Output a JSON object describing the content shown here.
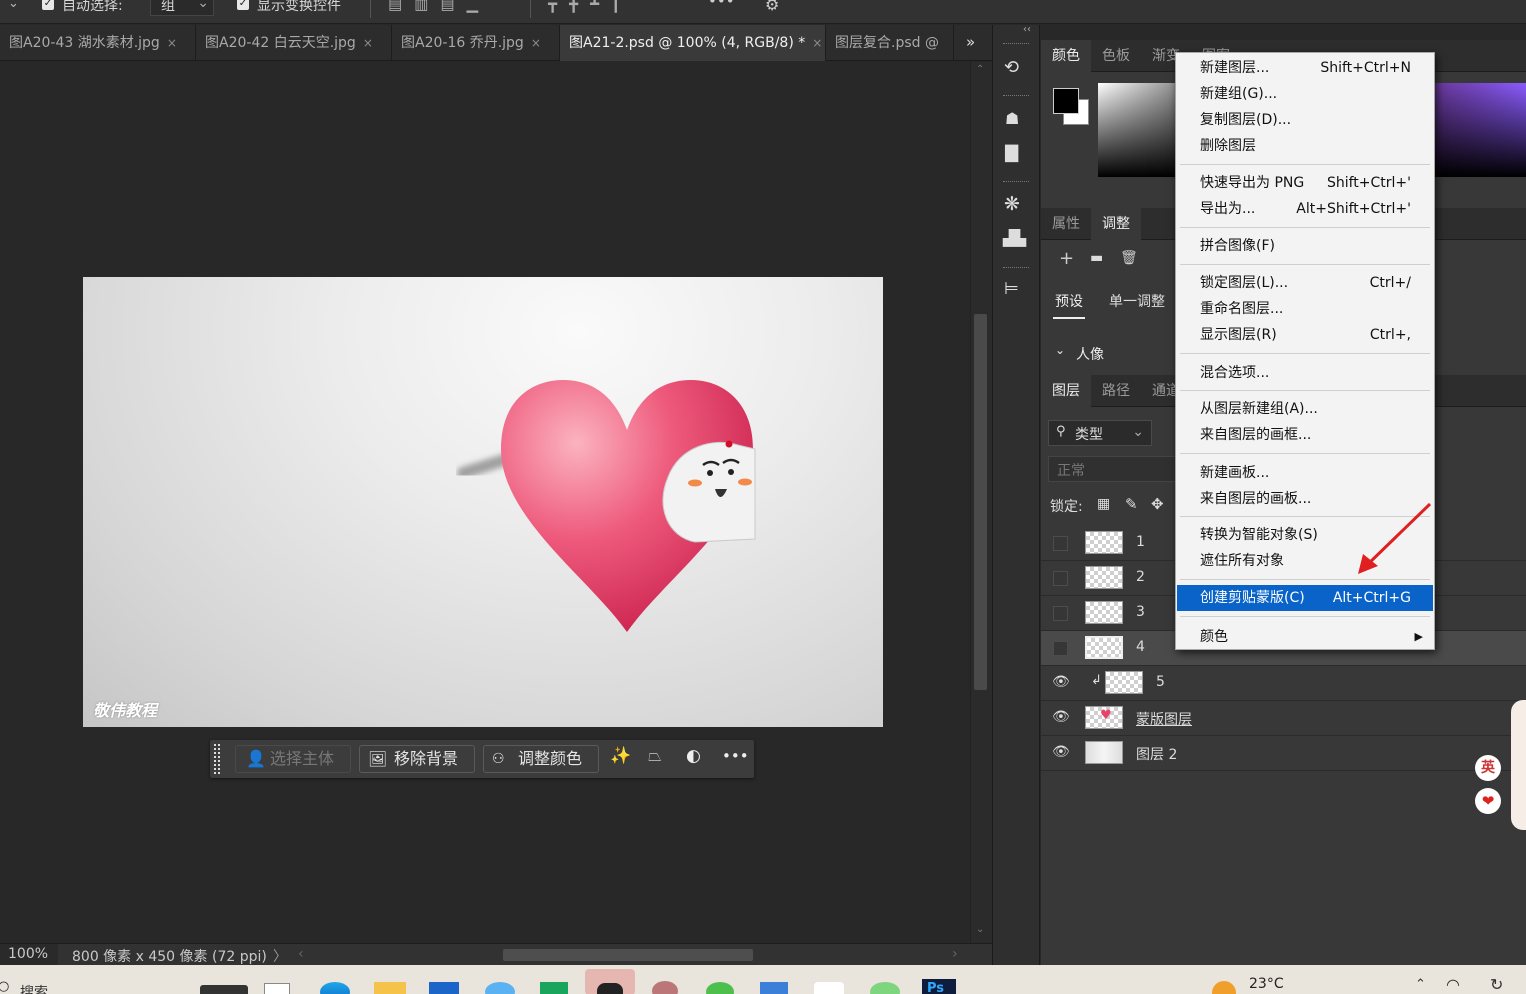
{
  "options_bar": {
    "auto_select_label": "自动选择:",
    "auto_select_value": "组",
    "show_transform_label": "显示变换控件"
  },
  "tabs": [
    {
      "label": "图A20-43 湖水素材.jpg",
      "close": "×"
    },
    {
      "label": "图A20-42 白云天空.jpg",
      "close": "×"
    },
    {
      "label": "图A20-16 乔丹.jpg",
      "close": "×"
    },
    {
      "label": "图A21-2.psd @ 100% (4, RGB/8) *",
      "close": "×"
    },
    {
      "label": "图层复合.psd @",
      "close": ""
    }
  ],
  "tabs_overflow": "»",
  "canvas": {
    "watermark": "敬伟教程"
  },
  "context_taskbar": {
    "select_subject": "选择主体",
    "remove_bg": "移除背景",
    "adjust_color": "调整颜色",
    "more": "•••"
  },
  "status": {
    "zoom": "100%",
    "doc_info": "800 像素 x 450 像素 (72 ppi)",
    "arrow": "〉"
  },
  "color_panel": {
    "tabs": [
      "颜色",
      "色板",
      "渐变",
      "图案"
    ],
    "collapse": "‹‹"
  },
  "adjust_panel": {
    "tabs": [
      "属性",
      "调整"
    ],
    "subtabs": [
      "预设",
      "单一调整"
    ],
    "group_label": "人像"
  },
  "layers_panel": {
    "tabs": [
      "图层",
      "路径",
      "通道"
    ],
    "filter_type": "类型",
    "blend_mode": "正常",
    "lock_label": "锁定:",
    "layers": [
      {
        "name": "1",
        "visible": false
      },
      {
        "name": "2",
        "visible": false
      },
      {
        "name": "3",
        "visible": false
      },
      {
        "name": "4",
        "visible": false
      },
      {
        "name": "5",
        "visible": true
      },
      {
        "name": "蒙版图层",
        "visible": true
      },
      {
        "name": "图层 2",
        "visible": true
      }
    ]
  },
  "context_menu": {
    "items": [
      {
        "label": "新建图层...",
        "shortcut": "Shift+Ctrl+N"
      },
      {
        "label": "新建组(G)...",
        "shortcut": ""
      },
      {
        "label": "复制图层(D)...",
        "shortcut": ""
      },
      {
        "label": "删除图层",
        "shortcut": ""
      },
      {
        "label": "快速导出为 PNG",
        "shortcut": "Shift+Ctrl+'"
      },
      {
        "label": "导出为...",
        "shortcut": "Alt+Shift+Ctrl+'"
      },
      {
        "label": "拼合图像(F)",
        "shortcut": ""
      },
      {
        "label": "锁定图层(L)...",
        "shortcut": "Ctrl+/"
      },
      {
        "label": "重命名图层...",
        "shortcut": ""
      },
      {
        "label": "显示图层(R)",
        "shortcut": "Ctrl+,"
      },
      {
        "label": "混合选项...",
        "shortcut": ""
      },
      {
        "label": "从图层新建组(A)...",
        "shortcut": ""
      },
      {
        "label": "来自图层的画框...",
        "shortcut": ""
      },
      {
        "label": "新建画板...",
        "shortcut": ""
      },
      {
        "label": "来自图层的画板...",
        "shortcut": ""
      },
      {
        "label": "转换为智能对象(S)",
        "shortcut": ""
      },
      {
        "label": "遮住所有对象",
        "shortcut": ""
      },
      {
        "label": "创建剪贴蒙版(C)",
        "shortcut": "Alt+Ctrl+G"
      },
      {
        "label": "颜色",
        "shortcut": ""
      }
    ],
    "highlighted_index": 17
  },
  "taskbar": {
    "search": "搜索",
    "weather": "23°C"
  },
  "ime": {
    "label": "英"
  },
  "colors": {
    "menu_highlight": "#0a63c9",
    "annotation_arrow": "#e02020",
    "heart": "#e8446a"
  }
}
